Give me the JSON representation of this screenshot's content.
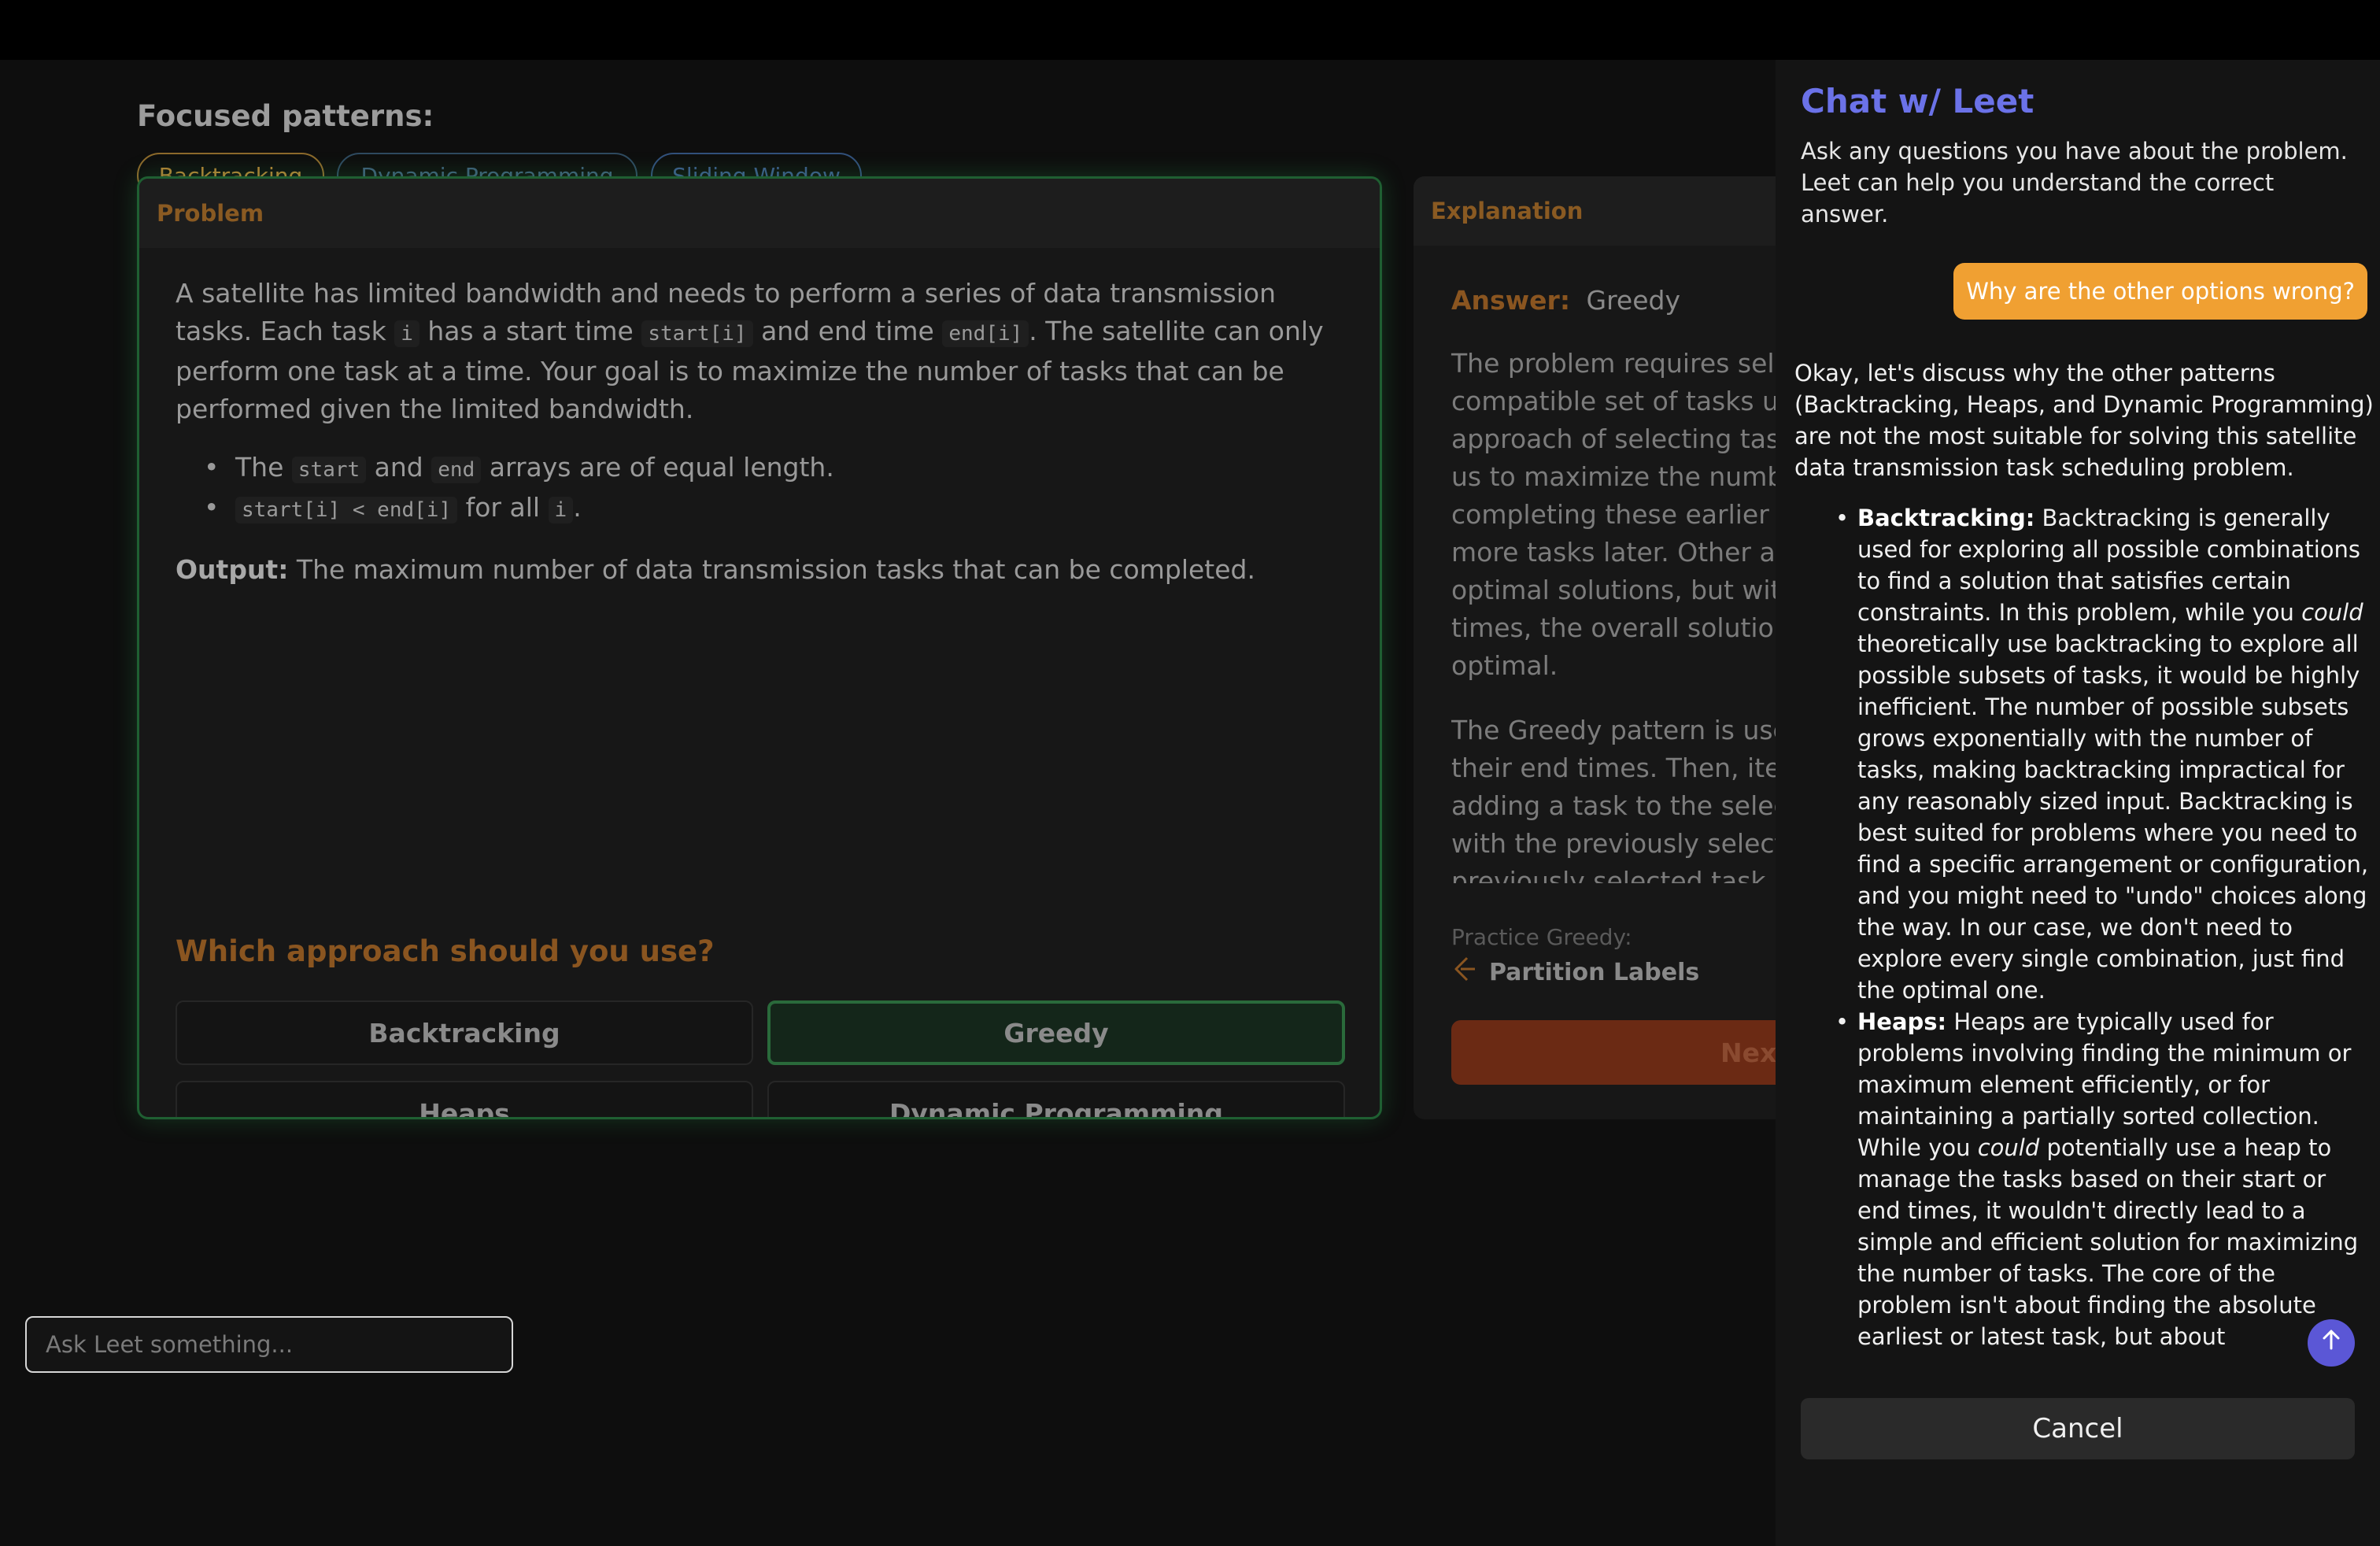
{
  "patterns": {
    "title": "Focused patterns:",
    "chips": [
      "Backtracking",
      "Dynamic Programming",
      "Sliding Window"
    ]
  },
  "problem": {
    "header": "Problem",
    "p1_a": "A satellite has limited bandwidth and needs to perform a series of data transmission tasks. Each task",
    "code_i": "i",
    "p1_b": "has a start time",
    "code_start": "start[i]",
    "p1_c": "and end time",
    "code_end": "end[i]",
    "p1_d": ". The satellite can only perform one task at a time. Your goal is to maximize the number of tasks that can be performed given the limited bandwidth.",
    "b1_a": "The",
    "b1_code1": "start",
    "b1_b": "and",
    "b1_code2": "end",
    "b1_c": "arrays are of equal length.",
    "b2_code": "start[i] < end[i]",
    "b2_a": "for all",
    "b2_code2": "i",
    "b2_b": ".",
    "output_label": "Output:",
    "output_text": "The maximum number of data transmission tasks that can be completed.",
    "question": "Which approach should you use?",
    "options": [
      "Backtracking",
      "Greedy",
      "Heaps",
      "Dynamic Programming"
    ]
  },
  "explanation": {
    "header": "Explanation",
    "answer_label": "Answer:",
    "answer_value": "Greedy",
    "para1": "The problem requires sele\ncompatible set of tasks ur\napproach of selecting tas\nus to maximize the numbe\ncompleting these earlier t\nmore tasks later. Other ap\noptimal solutions, but with\ntimes, the overall solution\noptimal.",
    "para2": "The Greedy pattern is usec\ntheir end times. Then, itera\nadding a task to the selec\nwith the previously selecte\npreviously selected task is",
    "practice_label": "Practice Greedy:",
    "practice_link": "Partition Labels",
    "next_label": "Next"
  },
  "chat": {
    "title": "Chat w/ Leet",
    "subtitle": "Ask any questions you have about the problem.\nLeet can help you understand the correct answer.",
    "user_message": "Why are the other options wrong?",
    "reply_intro": "Okay, let's discuss why the other patterns (Backtracking, Heaps, and Dynamic Programming) are not the most suitable for solving this satellite data transmission task scheduling problem.",
    "bt_label": "Backtracking:",
    "bt_a": "Backtracking is generally used for exploring all possible combinations to find a solution that satisfies certain constraints. In this problem, while you",
    "bt_em": "could",
    "bt_b": "theoretically use backtracking to explore all possible subsets of tasks, it would be highly inefficient. The number of possible subsets grows exponentially with the number of tasks, making backtracking impractical for any reasonably sized input. Backtracking is best suited for problems where you need to find a specific arrangement or configuration, and you might need to \"undo\" choices along the way. In our case, we don't need to explore every single combination, just find the optimal one.",
    "heaps_label": "Heaps:",
    "heaps_a": "Heaps are typically used for problems involving finding the minimum or maximum element efficiently, or for maintaining a partially sorted collection. While you",
    "heaps_em": "could",
    "heaps_b": "potentially use a heap to manage the tasks based on their start or end times, it wouldn't directly lead to a simple and efficient solution for maximizing the number of tasks. The core of the problem isn't about finding the absolute earliest or latest task, but about",
    "input_placeholder": "Ask Leet something...",
    "cancel_label": "Cancel"
  }
}
